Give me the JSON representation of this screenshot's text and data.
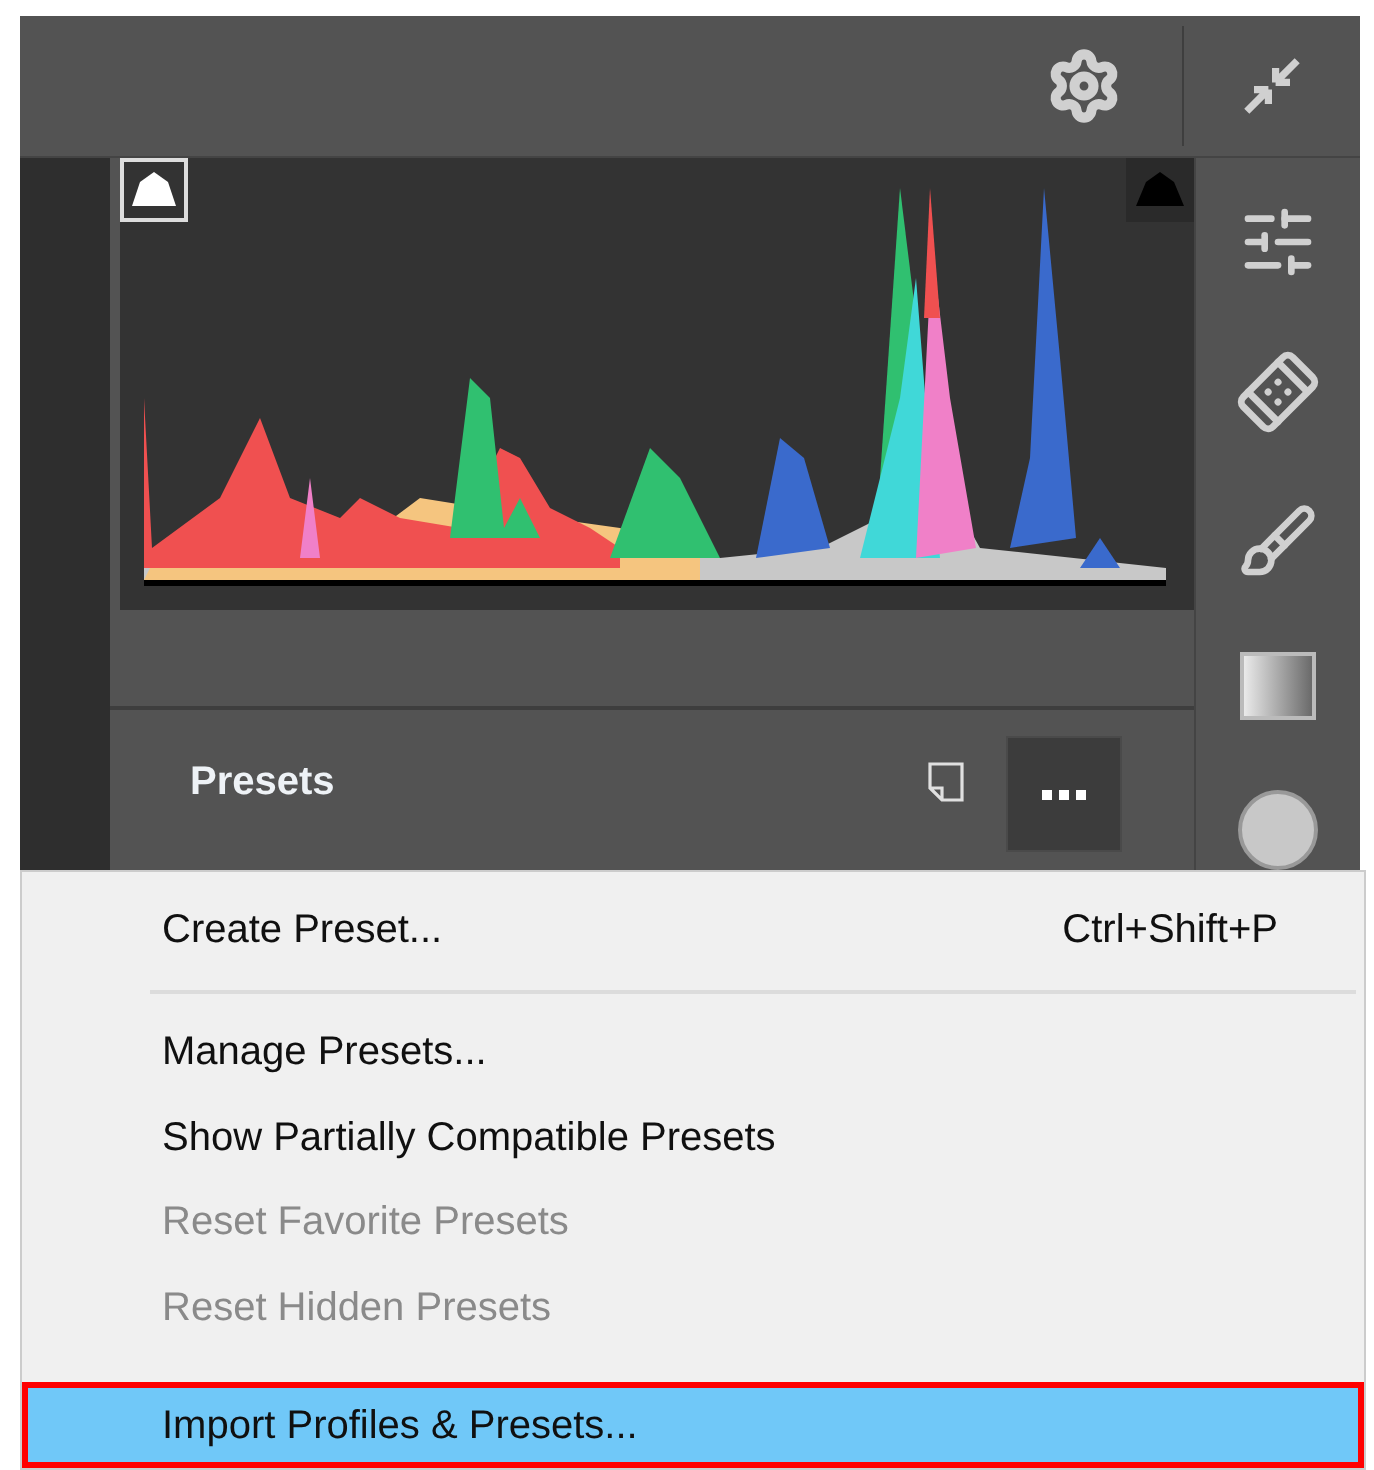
{
  "panel": {
    "title": "Presets"
  },
  "menu": [
    {
      "kind": "item",
      "label": "Create Preset...",
      "shortcut": "Ctrl+Shift+P",
      "disabled": false,
      "selected": false
    },
    {
      "kind": "separator"
    },
    {
      "kind": "item",
      "label": "Manage Presets...",
      "disabled": false,
      "selected": false
    },
    {
      "kind": "item",
      "label": "Show Partially Compatible Presets",
      "disabled": false,
      "selected": false
    },
    {
      "kind": "item",
      "label": "Reset Favorite Presets",
      "disabled": true,
      "selected": false
    },
    {
      "kind": "item",
      "label": "Reset Hidden Presets",
      "disabled": true,
      "selected": false
    },
    {
      "kind": "item",
      "label": "Import Profiles & Presets...",
      "disabled": false,
      "selected": true
    }
  ]
}
